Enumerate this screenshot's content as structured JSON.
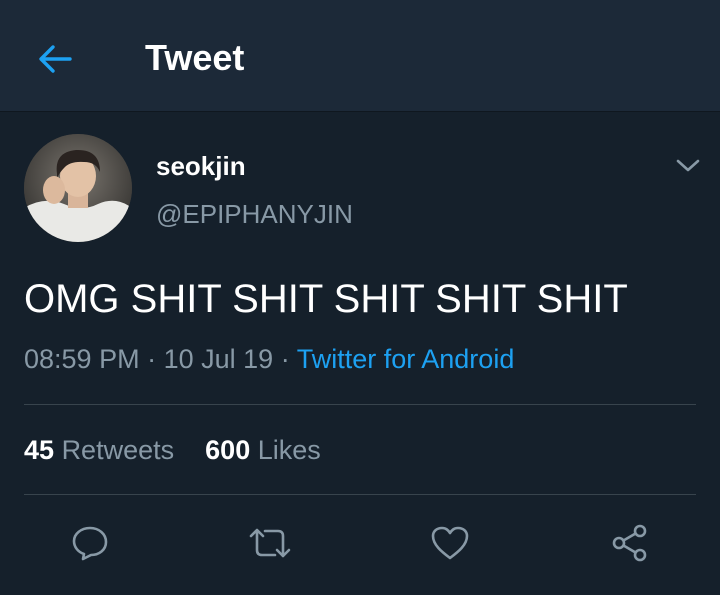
{
  "header": {
    "title": "Tweet",
    "back_icon": "arrow-left-icon"
  },
  "tweet": {
    "display_name": "seokjin",
    "handle": "@EPIPHANYJIN",
    "text": "OMG SHIT SHIT SHIT SHIT SHIT",
    "time": "08:59 PM",
    "date": "10 Jul 19",
    "separator": "·",
    "source": "Twitter for Android",
    "retweets_count": "45",
    "retweets_label": "Retweets",
    "likes_count": "600",
    "likes_label": "Likes"
  },
  "actions": {
    "reply_icon": "reply-icon",
    "retweet_icon": "retweet-icon",
    "like_icon": "heart-icon",
    "share_icon": "share-icon"
  },
  "colors": {
    "background": "#15202b",
    "header_bg": "#1c2938",
    "accent": "#1da1f2",
    "secondary_text": "#8899a6",
    "divider": "#38444d"
  }
}
